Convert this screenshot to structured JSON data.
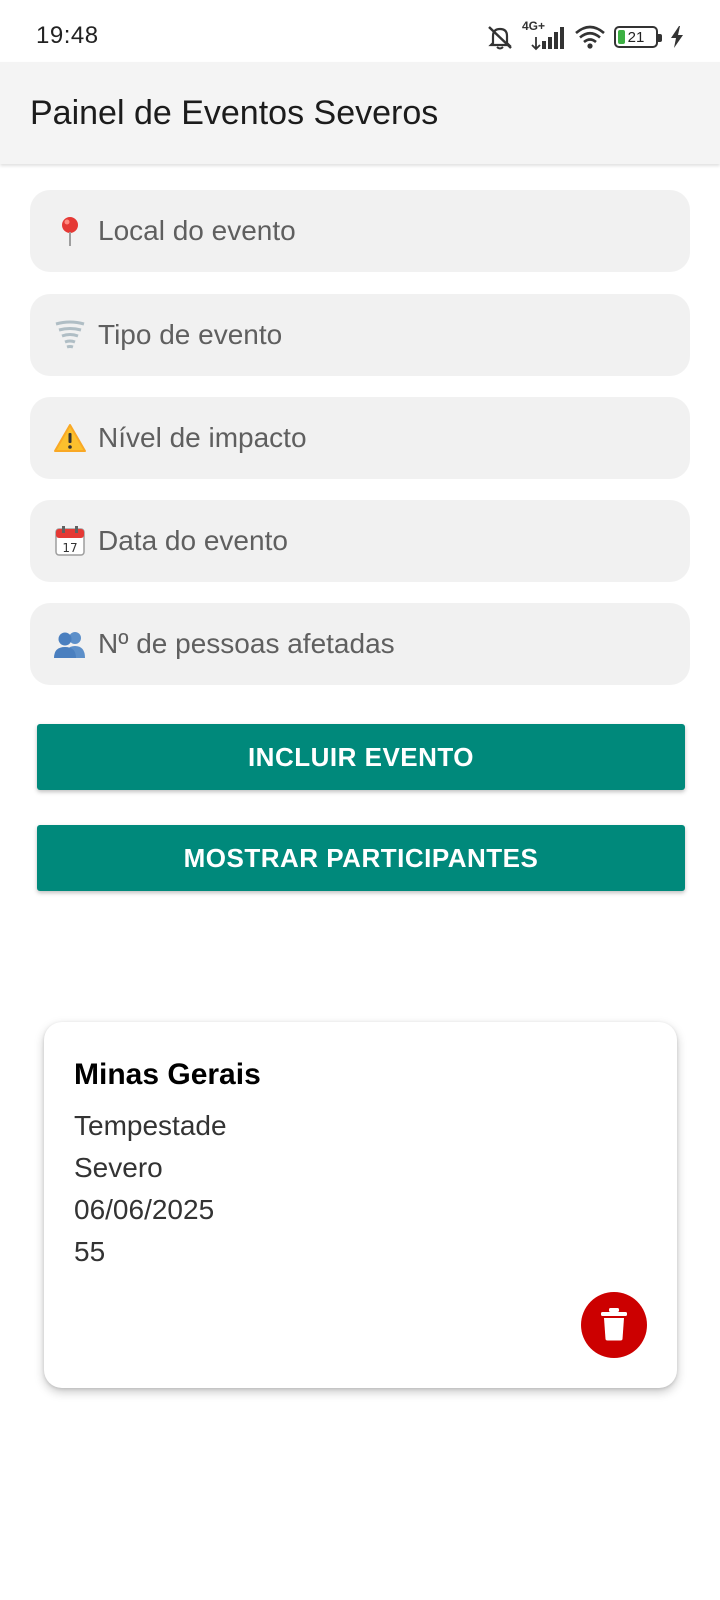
{
  "status_bar": {
    "time": "19:48",
    "network_label": "4G+",
    "battery_level": "21",
    "icons": [
      "mute-icon",
      "signal-icon",
      "wifi-icon",
      "battery-icon",
      "charging-icon"
    ]
  },
  "app_bar": {
    "title": "Painel de Eventos Severos"
  },
  "form": {
    "local_placeholder": "Local do evento",
    "local_icon": "pin-emoji",
    "tipo_placeholder": "Tipo de evento",
    "tipo_icon": "tornado-emoji",
    "nivel_placeholder": "Nível de impacto",
    "nivel_icon": "warning-emoji",
    "data_placeholder": "Data do evento",
    "data_icon": "calendar-emoji",
    "pessoas_placeholder": "Nº de pessoas afetadas",
    "pessoas_icon": "people-emoji"
  },
  "buttons": {
    "incluir_label": "INCLUIR EVENTO",
    "mostrar_label": "MOSTRAR PARTICIPANTES"
  },
  "event_card": {
    "local": "Minas Gerais",
    "tipo": "Tempestade",
    "nivel": "Severo",
    "data": "06/06/2025",
    "pessoas": "55",
    "delete_icon": "trash-icon"
  },
  "colors": {
    "accent": "#00897b",
    "danger": "#cc0000",
    "field_bg": "#f1f1f1",
    "app_bar_bg": "#f4f4f4"
  }
}
